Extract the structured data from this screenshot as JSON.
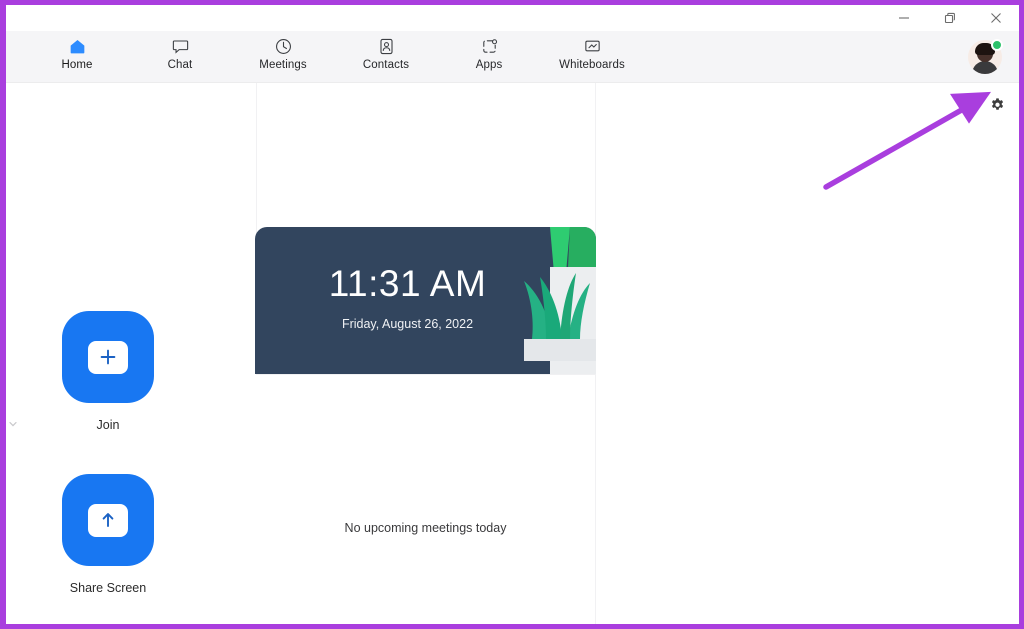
{
  "window": {
    "controls": {
      "minimize_label": "Minimize",
      "maximize_label": "Restore",
      "close_label": "Close"
    }
  },
  "navbar": {
    "items": [
      {
        "label": "Home",
        "icon": "home-icon",
        "active": true
      },
      {
        "label": "Chat",
        "icon": "chat-icon",
        "active": false
      },
      {
        "label": "Meetings",
        "icon": "clock-icon",
        "active": false
      },
      {
        "label": "Contacts",
        "icon": "contacts-icon",
        "active": false
      },
      {
        "label": "Apps",
        "icon": "apps-icon",
        "active": false
      },
      {
        "label": "Whiteboards",
        "icon": "whiteboard-icon",
        "active": false
      }
    ],
    "avatar": {
      "name": "user-avatar",
      "status": "available",
      "status_color": "#2dc26b"
    }
  },
  "toolbar": {
    "settings_icon": "gear-icon",
    "settings_label": "Settings"
  },
  "annotation": {
    "arrow_color": "#a93ede",
    "points_to": "gear-icon"
  },
  "sidebar": {
    "collapse_icon": "chevron-down-icon"
  },
  "actions": [
    {
      "label": "Join",
      "icon": "plus-icon",
      "tile_color": "#1877f2"
    },
    {
      "label": "Share Screen",
      "icon": "up-arrow-icon",
      "tile_color": "#1877f2"
    }
  ],
  "meeting_card": {
    "time": "11:31 AM",
    "date": "Friday, August 26, 2022",
    "header_color": "#32455e",
    "empty_message": "No upcoming meetings today"
  }
}
